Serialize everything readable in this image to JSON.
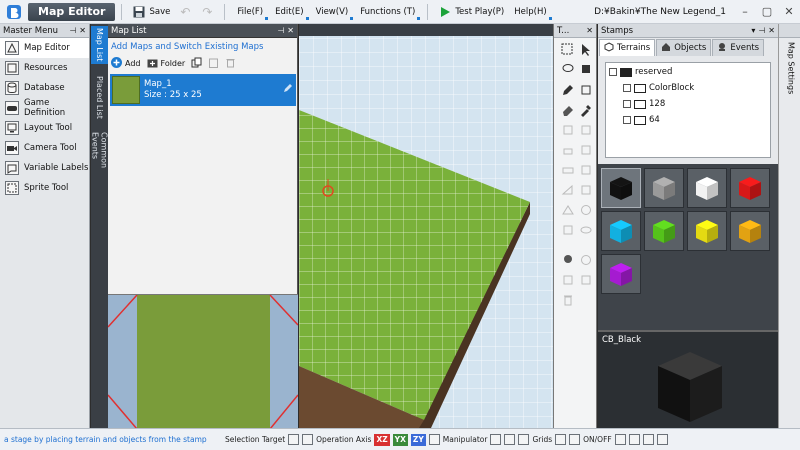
{
  "titlebar": {
    "brand": "Map Editor",
    "save_label": "Save",
    "menus": [
      "File(F)",
      "Edit(E)",
      "View(V)",
      "Functions (T)"
    ],
    "test_play": "Test Play(P)",
    "help": "Help(H)",
    "path": "D:¥Bakin¥The New Legend_1"
  },
  "master_menu": {
    "title": "Master Menu",
    "items": [
      {
        "label": "Map Editor",
        "icon": "map-editor-icon"
      },
      {
        "label": "Resources",
        "icon": "resources-icon"
      },
      {
        "label": "Database",
        "icon": "database-icon"
      },
      {
        "label": "Game Definition",
        "icon": "game-definition-icon"
      },
      {
        "label": "Layout Tool",
        "icon": "layout-tool-icon"
      },
      {
        "label": "Camera Tool",
        "icon": "camera-tool-icon"
      },
      {
        "label": "Variable Labels",
        "icon": "variable-labels-icon"
      },
      {
        "label": "Sprite Tool",
        "icon": "sprite-tool-icon"
      }
    ]
  },
  "vertical_tabs": [
    "Map List",
    "Placed List",
    "Common Events"
  ],
  "map_list": {
    "title": "Map List",
    "link": "Add Maps and Switch Existing Maps",
    "add_label": "Add",
    "folder_label": "Folder",
    "map_name": "Map_1",
    "map_size": "Size : 25 x 25"
  },
  "tools_title": "T...",
  "stamps": {
    "title": "Stamps",
    "tabs": [
      "Terrains",
      "Objects",
      "Events"
    ],
    "tree": {
      "root": "reserved",
      "children": [
        "ColorBlock",
        "128",
        "64"
      ]
    },
    "colors": [
      "#111111",
      "#9a9a9a",
      "#f2f2f2",
      "#d81818",
      "#12b0e0",
      "#55c21b",
      "#e4da12",
      "#e2a212",
      "#a51bd0"
    ],
    "selected_name": "CB_Black"
  },
  "right_strip_label": "Map Settings",
  "statusbar": {
    "message": "a stage by placing terrain and objects from the stamp",
    "selection_target": "Selection Target",
    "operation_axis": "Operation Axis",
    "axes": [
      "XZ",
      "YX",
      "ZY"
    ],
    "manipulator": "Manipulator",
    "grids": "Grids",
    "onoff": "ON/OFF"
  }
}
